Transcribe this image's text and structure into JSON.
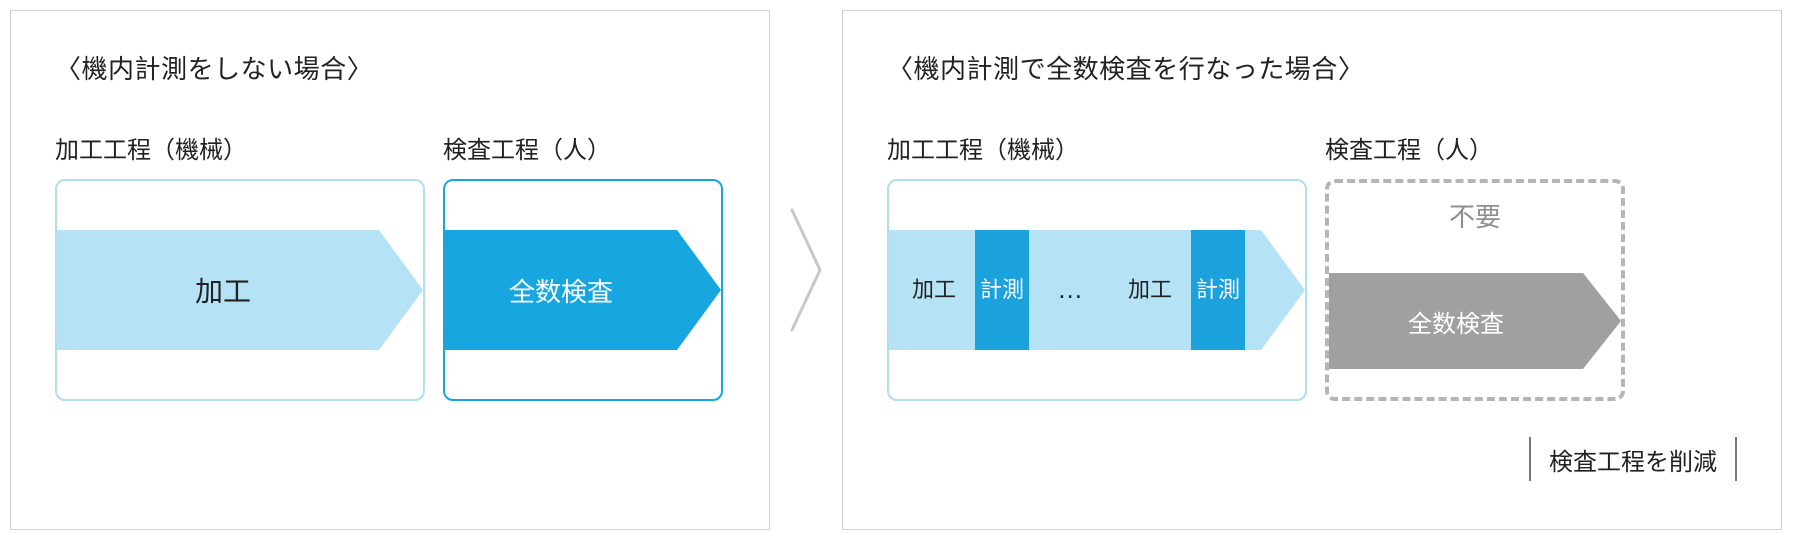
{
  "left": {
    "title": "〈機内計測をしない場合〉",
    "machining_label": "加工工程（機械）",
    "inspection_label": "検査工程（人）",
    "machining_arrow": "加工",
    "inspection_arrow": "全数検査"
  },
  "right": {
    "title": "〈機内計測で全数検査を行なった場合〉",
    "machining_label": "加工工程（機械）",
    "inspection_label": "検査工程（人）",
    "seg_kakou": "加工",
    "seg_keisoku": "計測",
    "seg_dots": "…",
    "unneeded": "不要",
    "inspection_arrow": "全数検査",
    "footer": "検査工程を削減"
  }
}
